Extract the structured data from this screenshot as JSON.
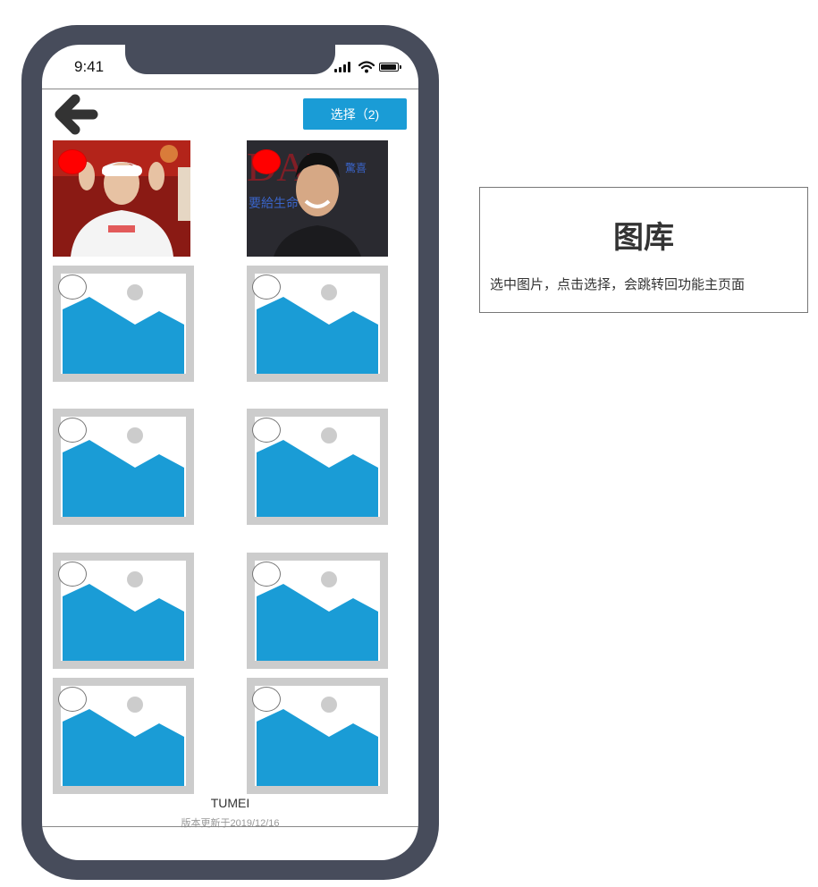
{
  "status_bar": {
    "time": "9:41"
  },
  "toolbar": {
    "back_icon": "arrow-left-icon",
    "select_label": "选择（2)"
  },
  "gallery": {
    "items": [
      {
        "type": "photo",
        "subject": "person-white-cap",
        "selected": true
      },
      {
        "type": "photo",
        "subject": "person-magazine-cover",
        "selected": true
      },
      {
        "type": "placeholder",
        "selected": false
      },
      {
        "type": "placeholder",
        "selected": false
      },
      {
        "type": "placeholder",
        "selected": false
      },
      {
        "type": "placeholder",
        "selected": false
      },
      {
        "type": "placeholder",
        "selected": false
      },
      {
        "type": "placeholder",
        "selected": false
      },
      {
        "type": "placeholder",
        "selected": false
      },
      {
        "type": "placeholder",
        "selected": false
      }
    ]
  },
  "footer": {
    "brand": "TUMEI",
    "version": "版本更新于2019/12/16"
  },
  "annotation": {
    "title": "图库",
    "description": "选中图片，点击选择，会跳转回功能主页面"
  },
  "colors": {
    "phone_frame": "#474c5b",
    "accent": "#1a9cd6",
    "selected": "#ff0000",
    "placeholder_frame": "#cccccc"
  }
}
